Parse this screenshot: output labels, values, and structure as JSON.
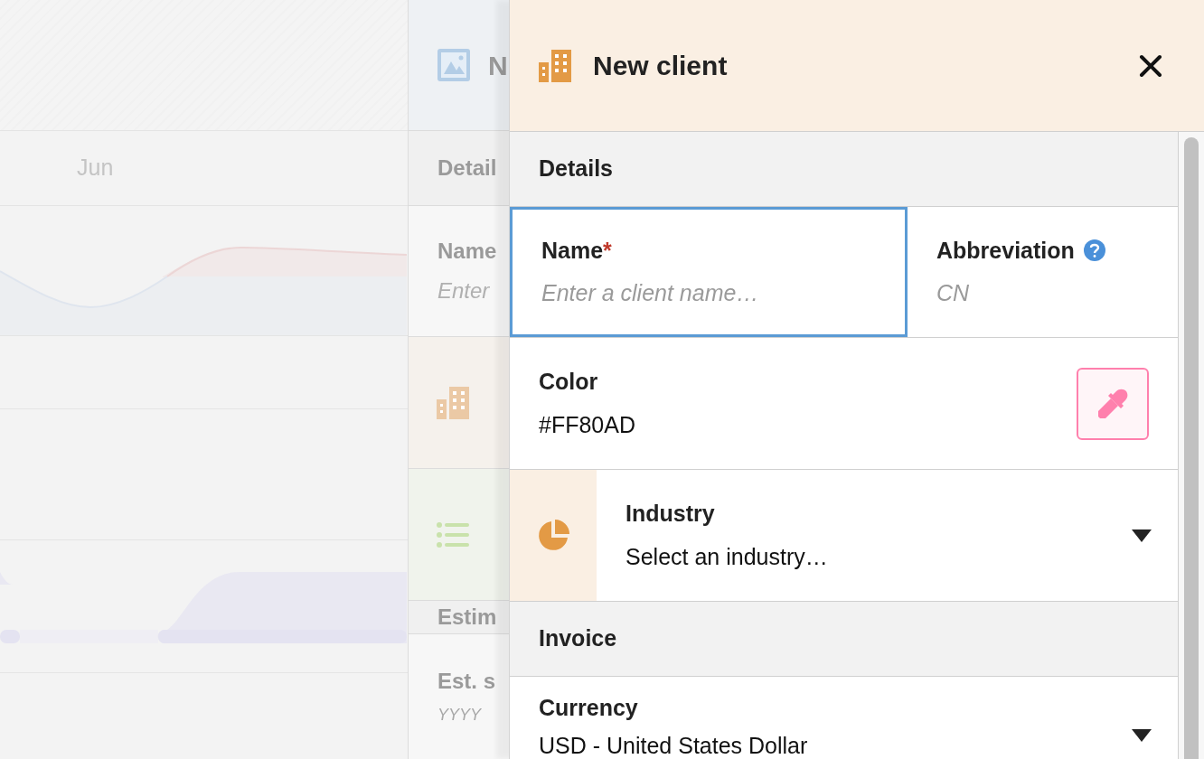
{
  "background": {
    "month_label": "Jun"
  },
  "behind_panel": {
    "title": "N",
    "section": "Detail",
    "field_label": "Name",
    "field_placeholder": "Enter",
    "section_2": "Estim",
    "field_label_2": "Est. s",
    "field_placeholder_2": "YYYY"
  },
  "drawer": {
    "title": "New client",
    "sections": [
      {
        "title": "Details",
        "rows": [
          {
            "kind": "pair",
            "fields": [
              {
                "kind": "text",
                "label": "Name",
                "required_mark": "*",
                "help": false,
                "focused": true,
                "placeholder": "Enter a client name…"
              },
              {
                "kind": "text",
                "label": "Abbreviation",
                "help": true,
                "focused": false,
                "placeholder": "CN"
              }
            ]
          },
          {
            "kind": "color",
            "label": "Color",
            "value": "#FF80AD",
            "color": "#ff80ad"
          },
          {
            "kind": "icon_select",
            "label": "Industry",
            "value": "Select an industry…"
          }
        ]
      },
      {
        "title": "Invoice",
        "rows": [
          {
            "kind": "select",
            "label": "Currency",
            "value": "USD - United States Dollar"
          }
        ]
      }
    ]
  }
}
